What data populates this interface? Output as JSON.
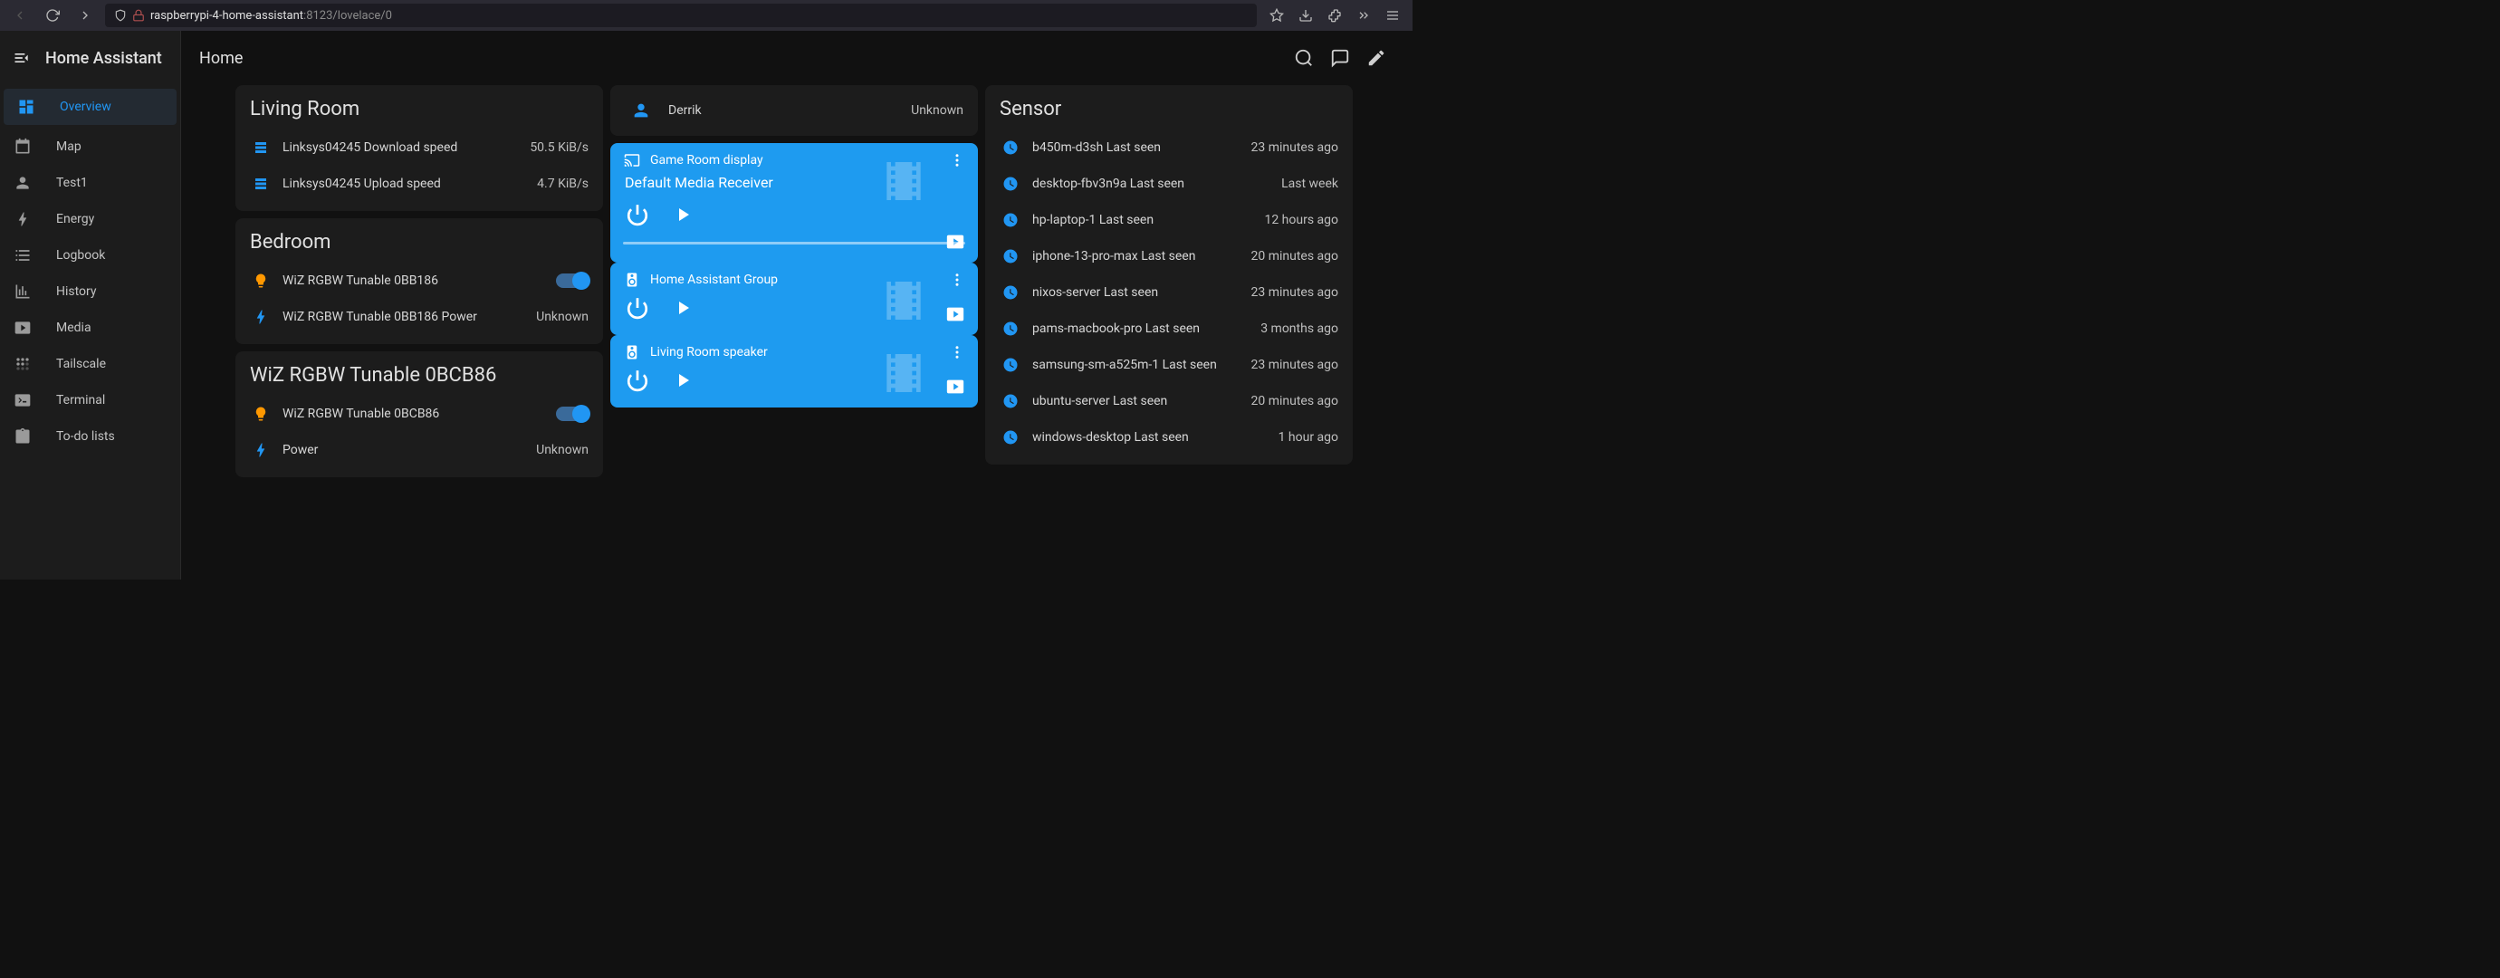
{
  "browser": {
    "url_host": "raspberrypi-4-home-assistant",
    "url_port": ":8123",
    "url_path": "/lovelace/0"
  },
  "app_title": "Home Assistant",
  "page_title": "Home",
  "sidebar": [
    {
      "label": "Overview",
      "icon": "dashboard",
      "active": true
    },
    {
      "label": "Map",
      "icon": "map",
      "active": false
    },
    {
      "label": "Test1",
      "icon": "person",
      "active": false
    },
    {
      "label": "Energy",
      "icon": "flash",
      "active": false
    },
    {
      "label": "Logbook",
      "icon": "list",
      "active": false
    },
    {
      "label": "History",
      "icon": "chart",
      "active": false
    },
    {
      "label": "Media",
      "icon": "media",
      "active": false
    },
    {
      "label": "Tailscale",
      "icon": "tailscale",
      "active": false
    },
    {
      "label": "Terminal",
      "icon": "terminal",
      "active": false
    },
    {
      "label": "To-do lists",
      "icon": "clipboard",
      "active": false
    }
  ],
  "living_room": {
    "title": "Living Room",
    "rows": [
      {
        "label": "Linksys04245 Download speed",
        "value": "50.5 KiB/s",
        "icon": "server"
      },
      {
        "label": "Linksys04245 Upload speed",
        "value": "4.7 KiB/s",
        "icon": "server"
      }
    ]
  },
  "bedroom": {
    "title": "Bedroom",
    "rows": [
      {
        "label": "WiZ RGBW Tunable 0BB186",
        "icon": "bulb",
        "toggle": true
      },
      {
        "label": "WiZ RGBW Tunable 0BB186 Power",
        "value": "Unknown",
        "icon": "flash"
      }
    ]
  },
  "wiz_card": {
    "title": "WiZ RGBW Tunable 0BCB86",
    "rows": [
      {
        "label": "WiZ RGBW Tunable 0BCB86",
        "icon": "bulb",
        "toggle": true
      },
      {
        "label": "Power",
        "value": "Unknown",
        "icon": "flash"
      }
    ]
  },
  "person": {
    "name": "Derrik",
    "state": "Unknown"
  },
  "media": [
    {
      "title": "Game Room display",
      "subtitle": "Default Media Receiver",
      "icon": "cast",
      "progress": true
    },
    {
      "title": "Home Assistant Group",
      "icon": "speaker"
    },
    {
      "title": "Living Room speaker",
      "icon": "speaker"
    }
  ],
  "sensor": {
    "title": "Sensor",
    "rows": [
      {
        "label": "b450m-d3sh Last seen",
        "value": "23 minutes ago"
      },
      {
        "label": "desktop-fbv3n9a Last seen",
        "value": "Last week"
      },
      {
        "label": "hp-laptop-1 Last seen",
        "value": "12 hours ago"
      },
      {
        "label": "iphone-13-pro-max Last seen",
        "value": "20 minutes ago"
      },
      {
        "label": "nixos-server Last seen",
        "value": "23 minutes ago"
      },
      {
        "label": "pams-macbook-pro Last seen",
        "value": "3 months ago"
      },
      {
        "label": "samsung-sm-a525m-1 Last seen",
        "value": "23 minutes ago"
      },
      {
        "label": "ubuntu-server Last seen",
        "value": "20 minutes ago"
      },
      {
        "label": "windows-desktop Last seen",
        "value": "1 hour ago"
      }
    ]
  }
}
